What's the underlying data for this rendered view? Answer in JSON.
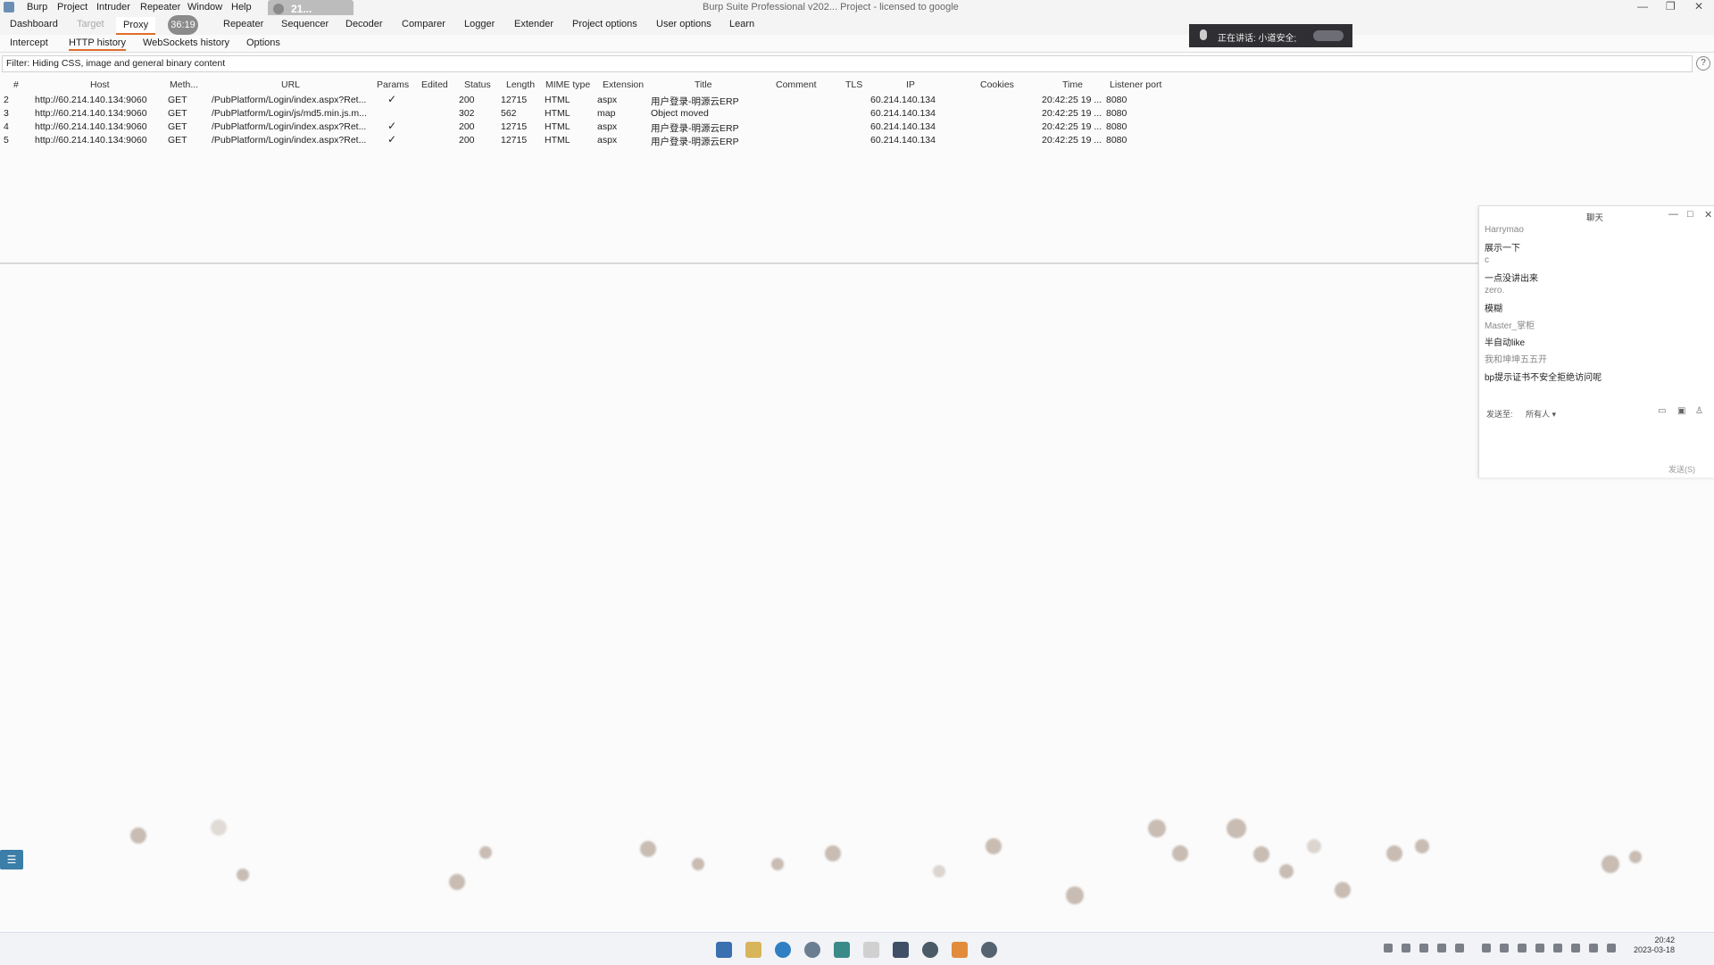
{
  "menubar": {
    "items": [
      "Burp",
      "Project",
      "Intruder",
      "Repeater",
      "Window",
      "Help"
    ],
    "window_title": "Burp Suite Professional v202... Project - licensed to google",
    "recorder_value": "21...",
    "timer": "36:19"
  },
  "main_tabs": [
    "Dashboard",
    "Target",
    "Proxy",
    "Repeater",
    "Sequencer",
    "Decoder",
    "Comparer",
    "Logger",
    "Extender",
    "Project options",
    "User options",
    "Learn"
  ],
  "sub_tabs": [
    "Intercept",
    "HTTP history",
    "WebSockets history",
    "Options"
  ],
  "filter": {
    "text": "Filter: Hiding CSS, image and general binary content"
  },
  "table": {
    "headers": [
      "#",
      "Host",
      "Meth...",
      "URL",
      "Params",
      "Edited",
      "Status",
      "Length",
      "MIME type",
      "Extension",
      "Title",
      "Comment",
      "TLS",
      "IP",
      "Cookies",
      "Time",
      "Listener port"
    ],
    "rows": [
      {
        "num": "2",
        "host": "http://60.214.140.134:9060",
        "method": "GET",
        "url": "/PubPlatform/Login/index.aspx?Ret...",
        "params": "✓",
        "status": "200",
        "length": "12715",
        "mime": "HTML",
        "ext": "aspx",
        "title": "用户登录-明源云ERP",
        "ip": "60.214.140.134",
        "time": "20:42:25 19 ...",
        "port": "8080"
      },
      {
        "num": "3",
        "host": "http://60.214.140.134:9060",
        "method": "GET",
        "url": "/PubPlatform/Login/js/md5.min.js.m...",
        "params": "",
        "status": "302",
        "length": "562",
        "mime": "HTML",
        "ext": "map",
        "title": "Object moved",
        "ip": "60.214.140.134",
        "time": "20:42:25 19 ...",
        "port": "8080"
      },
      {
        "num": "4",
        "host": "http://60.214.140.134:9060",
        "method": "GET",
        "url": "/PubPlatform/Login/index.aspx?Ret...",
        "params": "✓",
        "status": "200",
        "length": "12715",
        "mime": "HTML",
        "ext": "aspx",
        "title": "用户登录-明源云ERP",
        "ip": "60.214.140.134",
        "time": "20:42:25 19 ...",
        "port": "8080"
      },
      {
        "num": "5",
        "host": "http://60.214.140.134:9060",
        "method": "GET",
        "url": "/PubPlatform/Login/index.aspx?Ret...",
        "params": "✓",
        "status": "200",
        "length": "12715",
        "mime": "HTML",
        "ext": "aspx",
        "title": "用户登录-明源云ERP",
        "ip": "60.214.140.134",
        "time": "20:42:25 19 ...",
        "port": "8080"
      }
    ]
  },
  "voice": {
    "text": "正在讲话: 小道安全;"
  },
  "chat": {
    "title": "聊天",
    "messages": [
      {
        "text": "Harrymao",
        "kind": "name"
      },
      {
        "text": "展示一下",
        "kind": "text"
      },
      {
        "text": "c",
        "kind": "name"
      },
      {
        "text": "一点没讲出来",
        "kind": "text"
      },
      {
        "text": "zero.",
        "kind": "name"
      },
      {
        "text": "模糊",
        "kind": "text"
      },
      {
        "text": "Master_掌柜",
        "kind": "name"
      },
      {
        "text": "半自动like",
        "kind": "text"
      },
      {
        "text": "我和坤坤五五开",
        "kind": "name"
      },
      {
        "text": "bp提示证书不安全拒绝访问呢",
        "kind": "text"
      }
    ],
    "send_to_label": "发送至:",
    "send_to_value": "所有人 ▾",
    "send_button": "发送(S)"
  },
  "taskbar": {
    "clock_time": "20:42",
    "clock_date": "2023-03-18"
  }
}
